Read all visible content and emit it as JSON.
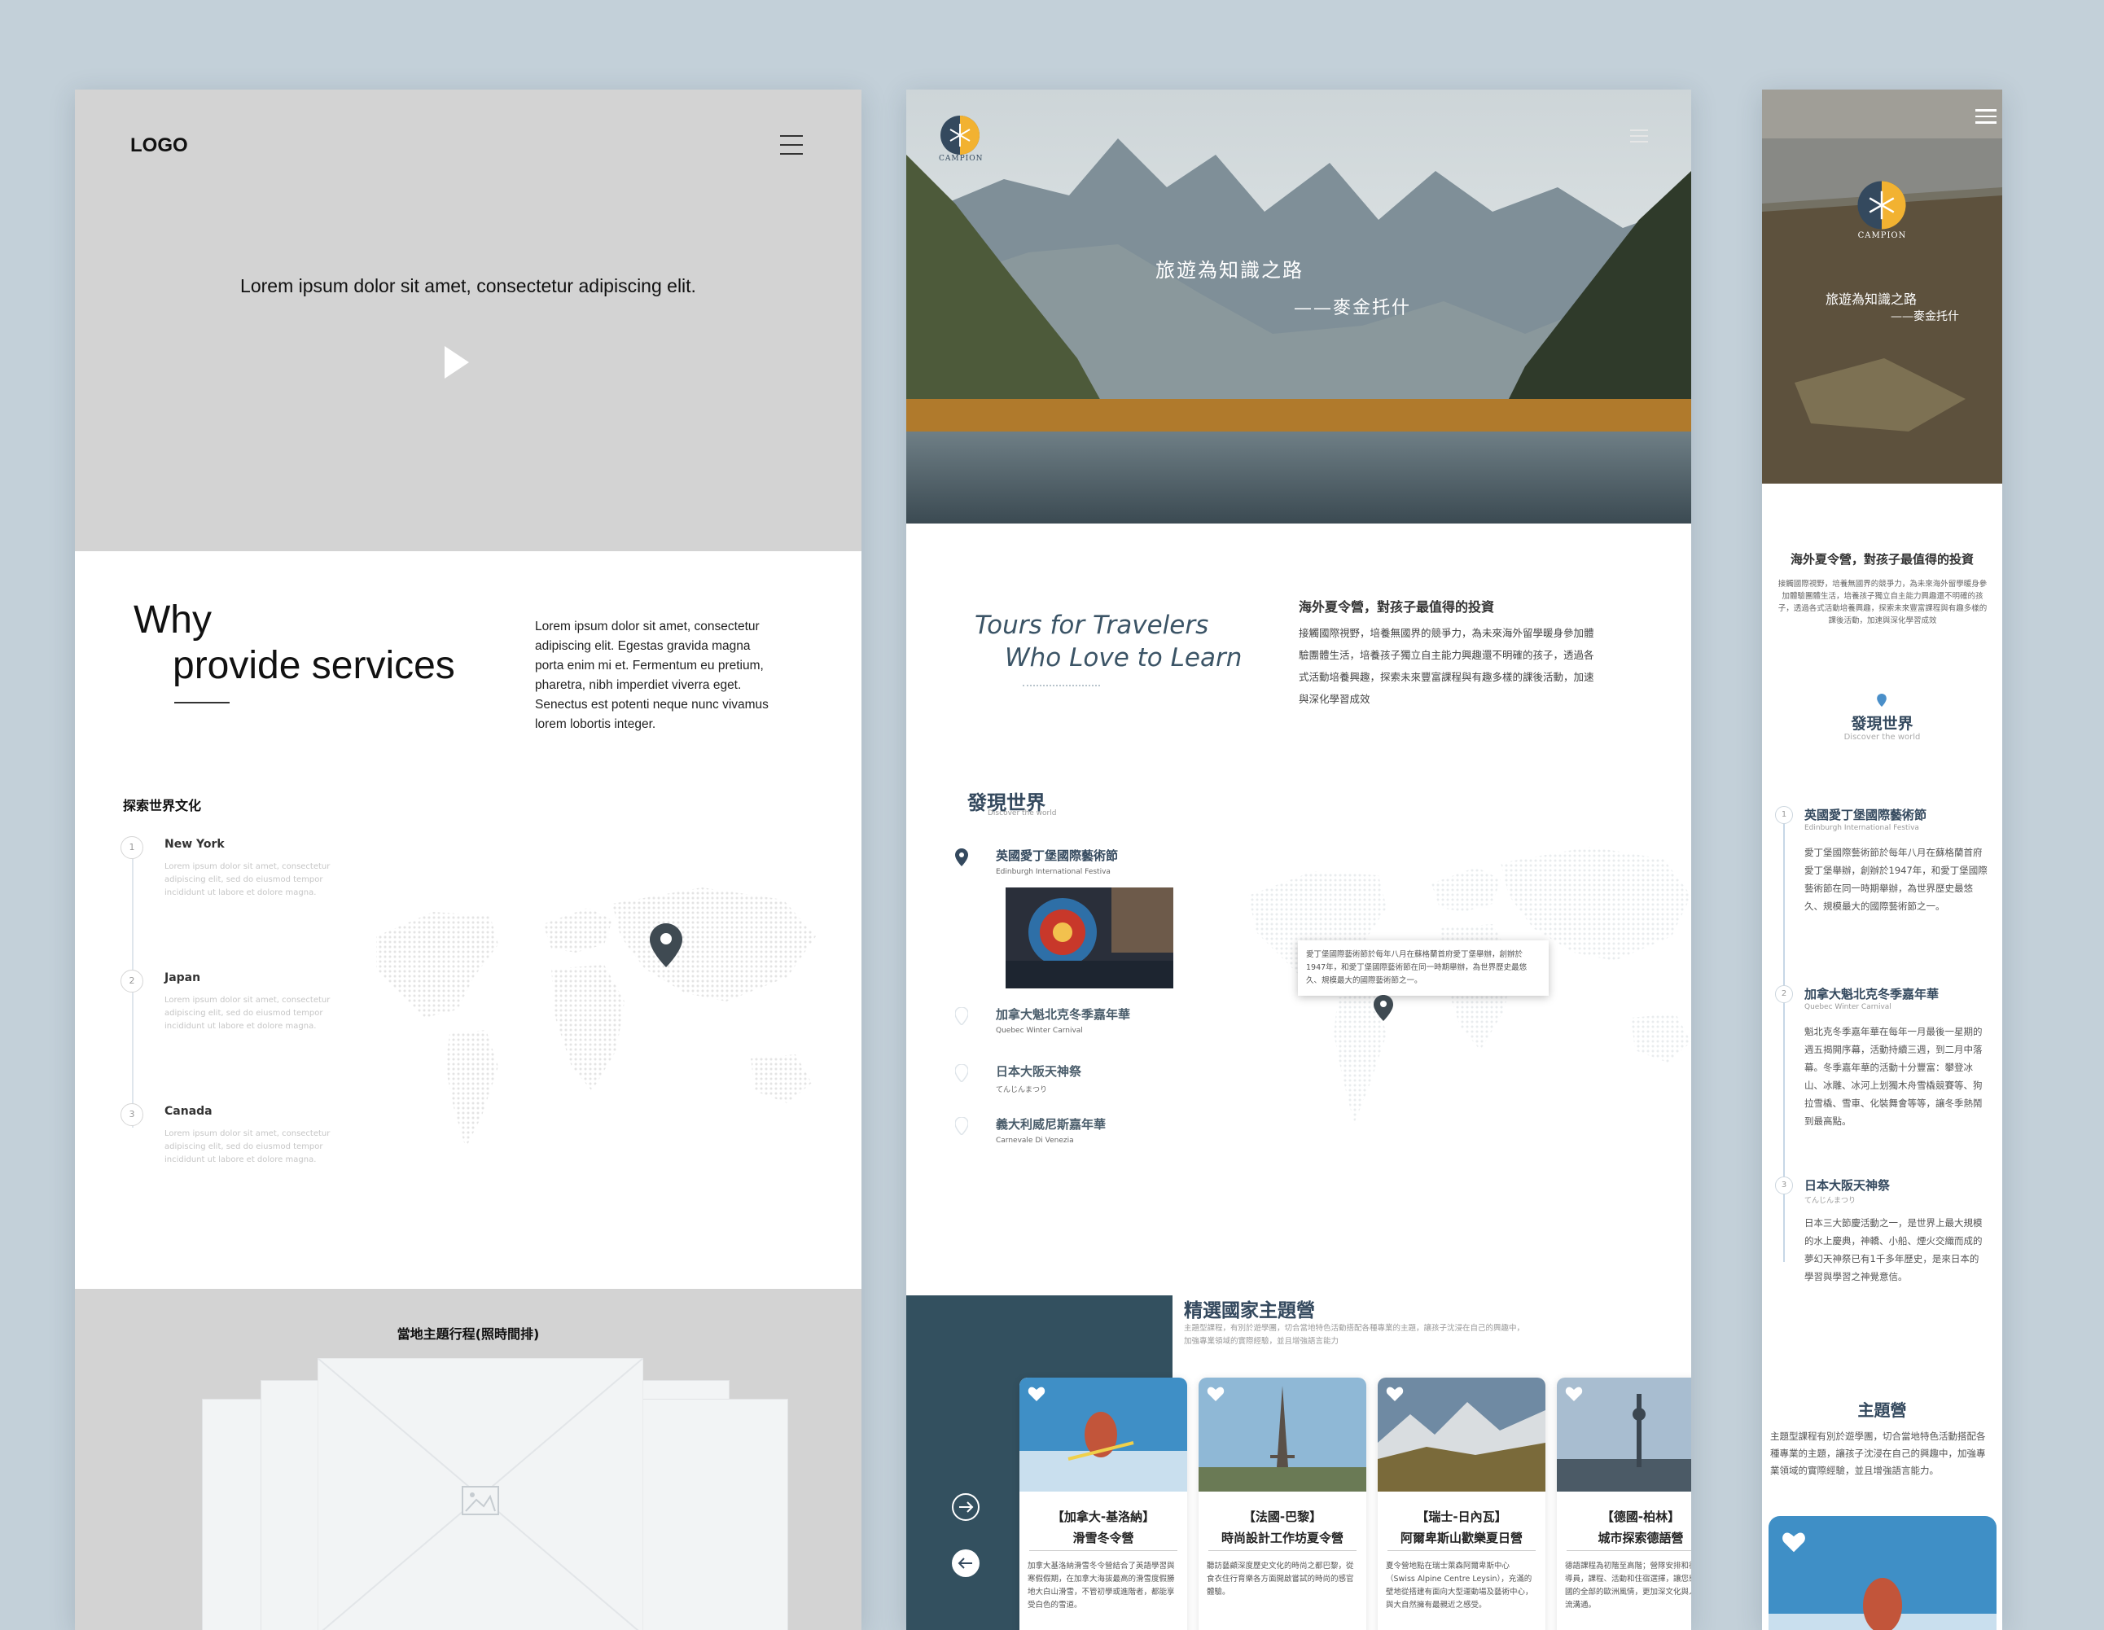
{
  "wireframe": {
    "logo": "LOGO",
    "menu_icon": "hamburger-icon",
    "hero_tagline": "Lorem ipsum dolor sit amet, consectetur adipiscing elit.",
    "play_icon": "play-icon",
    "why_line1": "Why",
    "why_line2": "provide services",
    "why_body": "Lorem ipsum dolor sit amet, consectetur adipiscing elit. Egestas gravida magna porta enim mi et. Fermentum eu pretium, pharetra, nibh imperdiet viverra eget. Senectus est potenti neque nunc vivamus lorem lobortis integer.",
    "explore_title": "探索世界文化",
    "steps": [
      {
        "num": "1",
        "title": "New York",
        "body": "Lorem ipsum dolor sit amet, consectetur adipiscing elit, sed do eiusmod tempor incididunt ut labore et dolore magna."
      },
      {
        "num": "2",
        "title": "Japan",
        "body": "Lorem ipsum dolor sit amet, consectetur adipiscing elit, sed do eiusmod tempor incididunt ut labore et dolore magna."
      },
      {
        "num": "3",
        "title": "Canada",
        "body": "Lorem ipsum dolor sit amet, consectetur adipiscing elit, sed do eiusmod tempor incididunt ut labore et dolore magna."
      }
    ],
    "schedule_title": "當地主題行程(照時間排)"
  },
  "desktop": {
    "logo_text": "CAMPION",
    "hero_title": "旅遊為知識之路",
    "hero_sub": "——麥金托什",
    "tours_line1": "Tours for Travelers",
    "tours_line2": "Who Love to Learn",
    "intro_title": "海外夏令營，對孩子最值得的投資",
    "intro_body": "接觸國際視野，培養無國界的競爭力，為未來海外留學暖身參加體驗團體生活，培養孩子獨立自主能力興趣還不明確的孩子，透過各式活動培養興趣，探索未來豐富課程與有趣多樣的課後活動，加速與深化學習成效",
    "discover_title": "發現世界",
    "discover_sub": "Discover the world",
    "events": [
      {
        "title": "英國愛丁堡國際藝術節",
        "sub": "Edinburgh International Festiva"
      },
      {
        "title": "加拿大魁北克冬季嘉年華",
        "sub": "Quebec Winter Carnival"
      },
      {
        "title": "日本大阪天神祭",
        "sub": "てんじんまつり"
      },
      {
        "title": "義大利威尼斯嘉年華",
        "sub": "Carnevale Di Venezia"
      }
    ],
    "tooltip": "愛丁堡國際藝術節於每年八月在蘇格蘭首府愛丁堡舉辦，創辦於1947年，和愛丁堡國際藝術節在同一時期舉辦，為世界歷史最悠久、規模最大的國際藝術節之一。",
    "featured_title": "精選國家主題營",
    "featured_sub": "主題型課程，有別於遊學團，切合當地特色活動搭配各種專業的主題，讓孩子沈浸在自己的興趣中，加強專業領域的實際經驗，並且增強語言能力",
    "cards": [
      {
        "t1": "【加拿大-基洛納】",
        "t2": "滑雪冬令營",
        "body": "加拿大基洛納滑雪冬令營結合了英語學習與寒假假期，在加拿大海拔最高的滑雪度假勝地大白山滑雪，不管初學或進階者，都能享受白色的雪道。"
      },
      {
        "t1": "【法國-巴黎】",
        "t2": "時尚設計工作坊夏令營",
        "body": "聽訪藝顧深度歷史文化的時尚之都巴黎，從食衣住行育樂各方面開啟嘗試的時尚的感官體驗。"
      },
      {
        "t1": "【瑞士-日內瓦】",
        "t2": "阿爾卑斯山歡樂夏日營",
        "body": "夏令營地點在瑞士萊森阿爾卑斯中心（Swiss Alpine Centre Leysin），充滿的壁地從搭建有面向大型運動場及藝術中心，與大自然擁有最親近之感受。"
      },
      {
        "t1": "【德國-柏林】",
        "t2": "城市探索德語營",
        "body": "德語課程為初階至高階；營隊安排和德國轉導員，課程、活動和住宿選擇，讓您感受德國的全部的歐洲風情，更加深文化與人文交流溝通。"
      }
    ],
    "arrow_next": "arrow-right-icon",
    "arrow_prev": "arrow-left-icon"
  },
  "mobile": {
    "logo_text": "CAMPION",
    "hero_title": "旅遊為知識之路",
    "hero_sub": "——麥金托什",
    "intro_title": "海外夏令營，對孩子最值得的投資",
    "intro_body": "接觸國際視野，培養無國界的競爭力，為未來海外留學暖身參加體驗團體生活，培養孩子獨立自主能力興趣還不明確的孩子，透過各式活動培養興趣，探索未來豐富課程與有趣多樣的課後活動，加速與深化學習成效",
    "discover_title": "發現世界",
    "discover_sub": "Discover the world",
    "events": [
      {
        "num": "1",
        "title": "英國愛丁堡國際藝術節",
        "sub": "Edinburgh International Festiva",
        "body": "愛丁堡國際藝術節於每年八月在蘇格蘭首府愛丁堡舉辦，創辦於1947年，和愛丁堡國際藝術節在同一時期舉辦，為世界歷史最悠久、規模最大的國際藝術節之一。"
      },
      {
        "num": "2",
        "title": "加拿大魁北克冬季嘉年華",
        "sub": "Quebec Winter Carnival",
        "body": "魁北克冬季嘉年華在每年一月最後一星期的週五揭開序幕，活動持續三週，到二月中落幕。冬季嘉年華的活動十分豐富：攀登冰山、冰雕、冰河上划獨木舟雪橇競賽等、狗拉雪橇、雪車、化裝舞會等等，讓冬季熱鬧到最高點。"
      },
      {
        "num": "3",
        "title": "日本大阪天神祭",
        "sub": "てんじんまつり",
        "body": "日本三大節慶活動之一，是世界上最大規模的水上慶典，神轎、小船、煙火交織而成的夢幻天神祭已有1千多年歷史，是來日本的學習與學習之神覺意信。"
      }
    ],
    "theme_title": "主題營",
    "theme_body": "主題型課程有別於遊學團，切合當地特色活動搭配各種專業的主題，讓孩子沈浸在自己的興趣中，加強專業領域的實際經驗，並且增強語言能力。"
  },
  "colors": {
    "background": "#c3d0d9",
    "brand_dark": "#34495e",
    "teal_block": "#33505f",
    "accent_yellow": "#f2b231"
  }
}
